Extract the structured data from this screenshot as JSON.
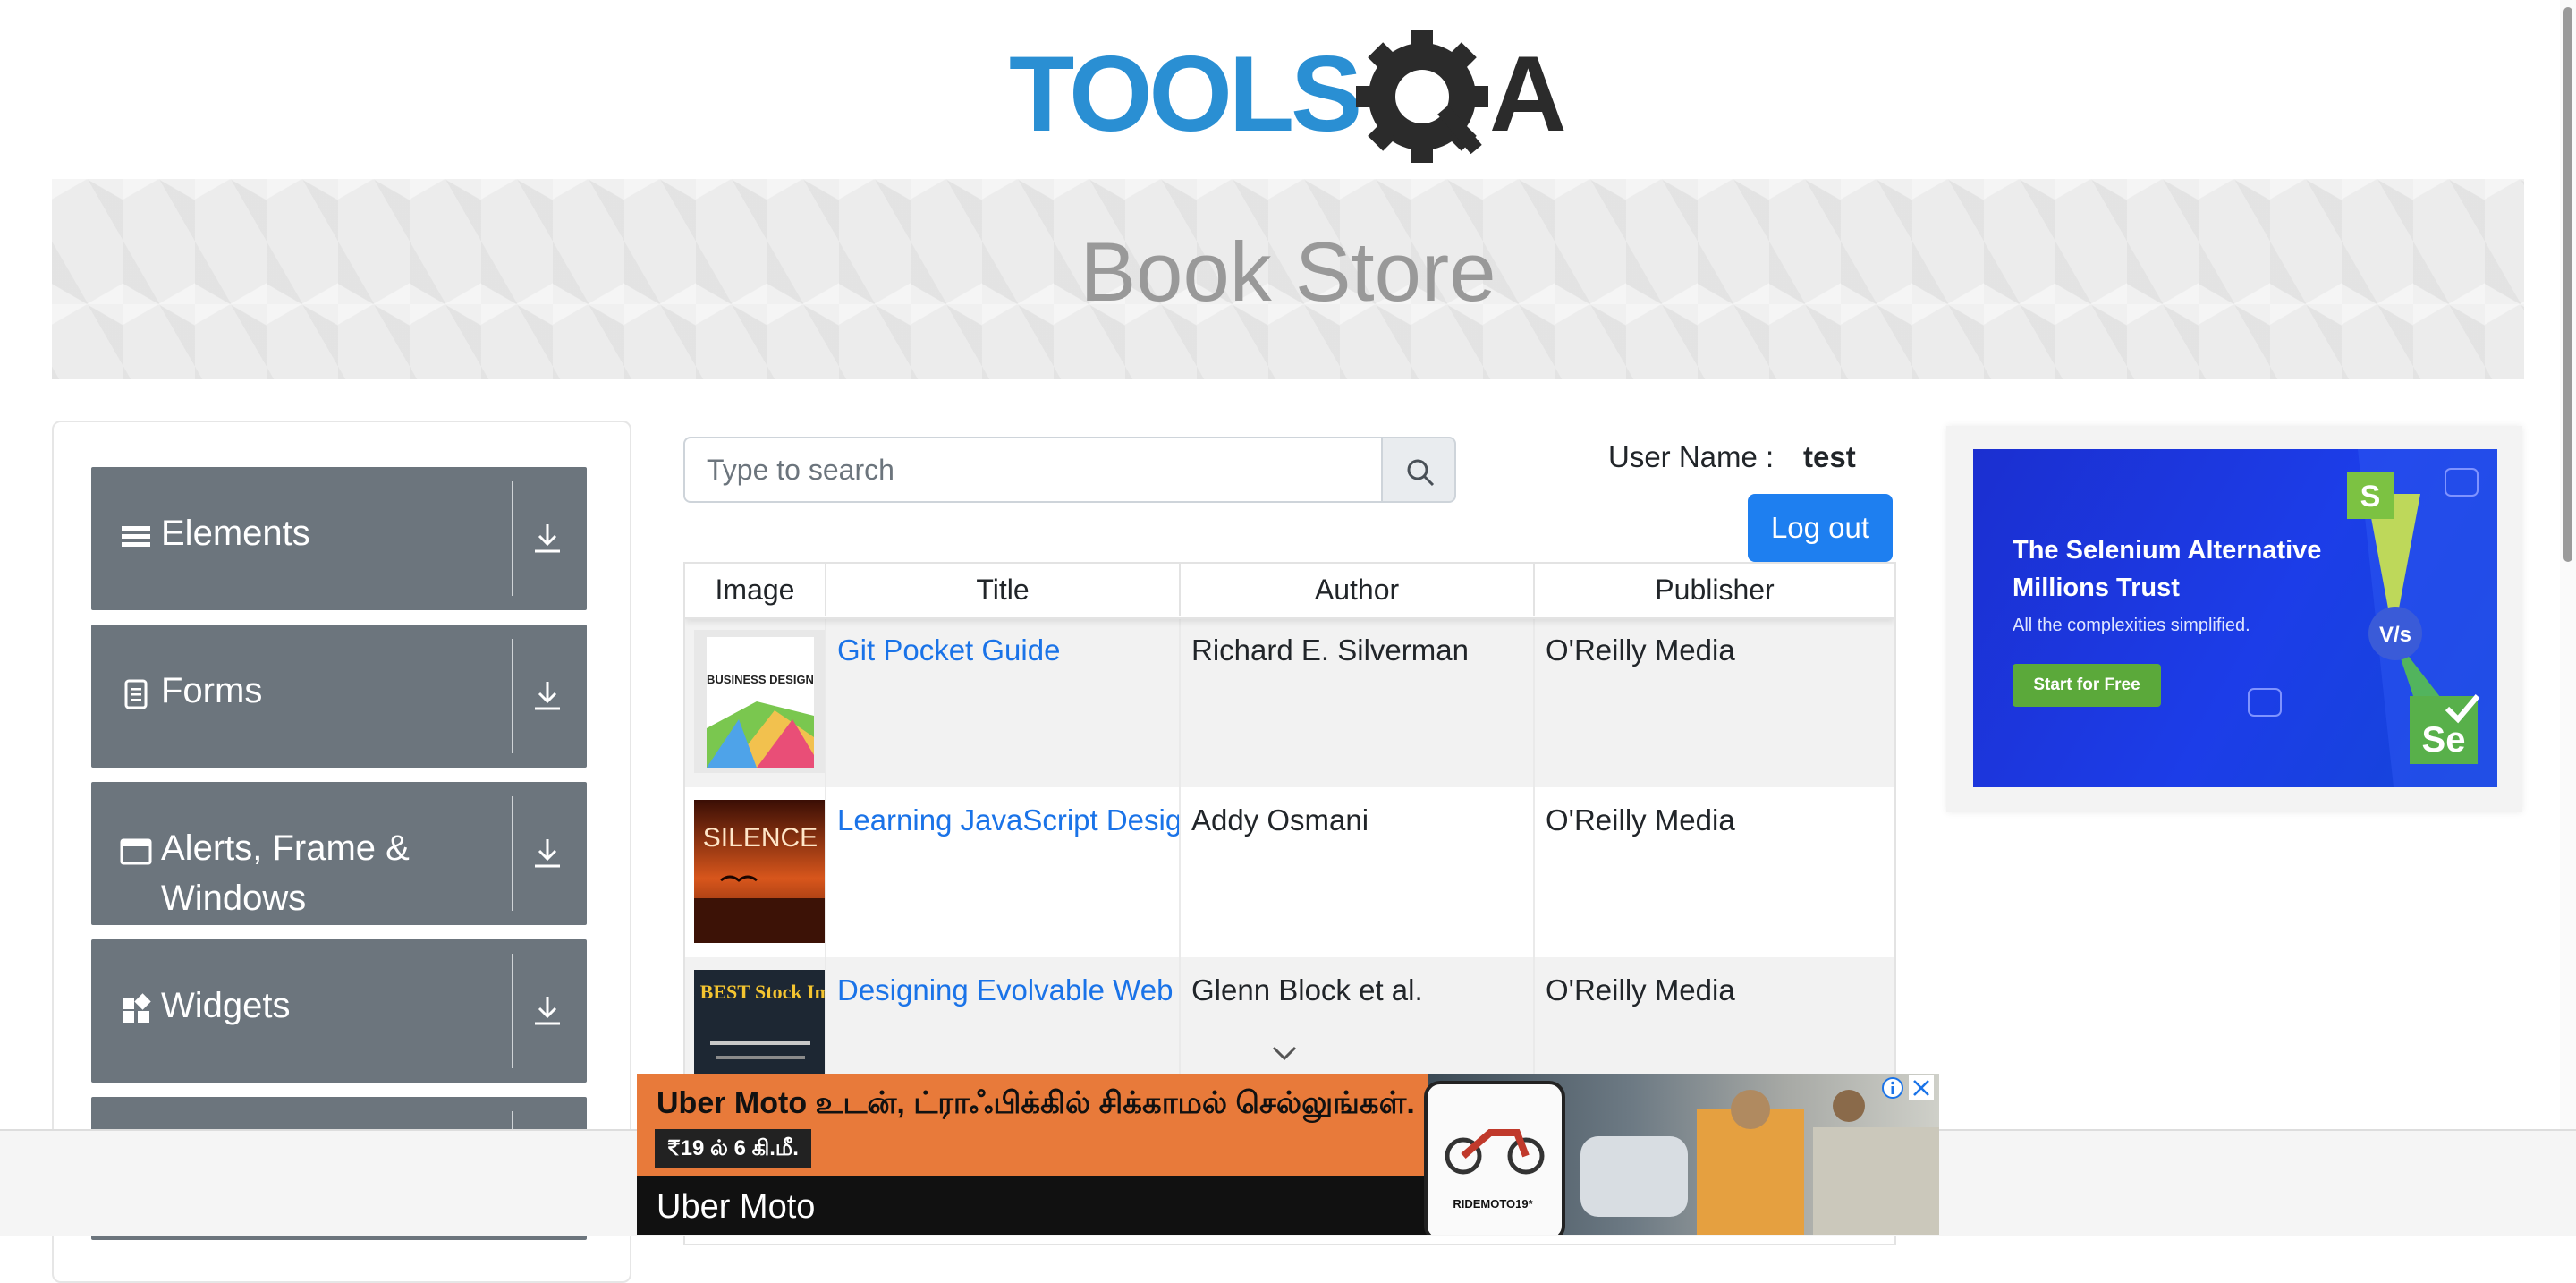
{
  "header": {
    "logo_alt": "TOOLSQA"
  },
  "banner": {
    "title": "Book Store"
  },
  "sidebar": {
    "groups": [
      {
        "label": "Elements",
        "icon": "menu-icon"
      },
      {
        "label": "Forms",
        "icon": "document-icon"
      },
      {
        "label": "Alerts, Frame & Windows",
        "icon": "window-icon"
      },
      {
        "label": "Widgets",
        "icon": "widgets-icon"
      }
    ]
  },
  "search": {
    "placeholder": "Type to search",
    "value": ""
  },
  "user": {
    "label": "User Name :",
    "value": "test",
    "logout_label": "Log out"
  },
  "table": {
    "columns": [
      "Image",
      "Title",
      "Author",
      "Publisher"
    ],
    "rows": [
      {
        "title": "Git Pocket Guide",
        "author": "Richard E. Silverman",
        "publisher": "O'Reilly Media",
        "cover_text": "BUSINESS DESIGN"
      },
      {
        "title": "Learning JavaScript Design Patterns",
        "author": "Addy Osmani",
        "publisher": "O'Reilly Media",
        "cover_text": "SILENCE"
      },
      {
        "title": "Designing Evolvable Web APIs with ASP.NET",
        "author": "Glenn Block et al.",
        "publisher": "O'Reilly Media",
        "cover_text": "THE BEST Stock Images"
      }
    ]
  },
  "ad_right": {
    "headline": "The Selenium Alternative Millions Trust",
    "sub": "All the complexities simplified.",
    "cta": "Start for Free",
    "badge_s": "S",
    "badge_se": "Se",
    "badge_vs": "V/s"
  },
  "ad_bottom": {
    "line1": "Uber Moto உடன், ட்ராஃபிக்கில் சிக்காமல் செல்லுங்கள்.",
    "price": "₹19 ல் 6 கி.மீ.",
    "brand": "Uber Moto",
    "phone_text": "RIDEMOTO19*"
  },
  "colors": {
    "sidebar": "#6c757d",
    "primary": "#1e7ff0",
    "link": "#1a73e8"
  }
}
